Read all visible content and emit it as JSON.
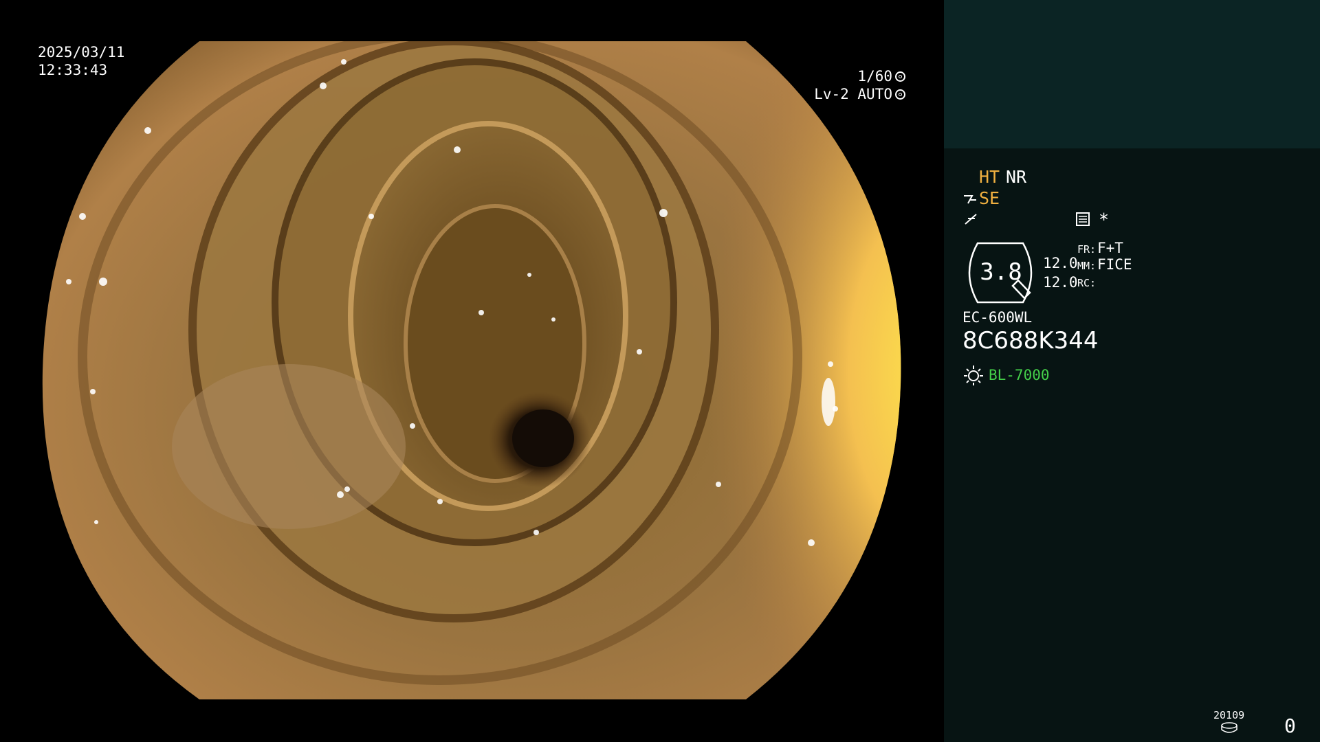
{
  "overlay": {
    "date": "2025/03/11",
    "time": "12:33:43",
    "shutter_speed": "1/60",
    "iris_mode": "Lv-2 AUTO"
  },
  "panel": {
    "ht_label": "HT",
    "nr_label": "NR",
    "se_label": "SE",
    "fr_label": "FR:",
    "fr_value": "F+T",
    "mm_label": "MM:",
    "mm_value": "FICE",
    "rc_label": "RC:",
    "gauge_value": "3.8",
    "gauge_value_top": "12.0",
    "gauge_value_bottom": "12.0",
    "scope_model": "EC-600WL",
    "scope_serial": "8C688K344",
    "light_source": "BL-7000",
    "counter_code": "20109",
    "counter_value": "0"
  },
  "icons": {
    "shutter": "aperture-icon",
    "iris": "iris-icon",
    "structure": "structure-enhance-icon",
    "contrast": "contrast-icon",
    "menu": "settings-list-icon",
    "asterisk": "asterisk-icon",
    "lens": "zoom-gauge-icon",
    "light": "light-source-icon",
    "disk": "storage-disk-icon"
  },
  "colors": {
    "panel_bg": "#071413",
    "panel_top_bg": "#0b2424",
    "accent_orange": "#f0b040",
    "accent_green": "#45d04a"
  }
}
